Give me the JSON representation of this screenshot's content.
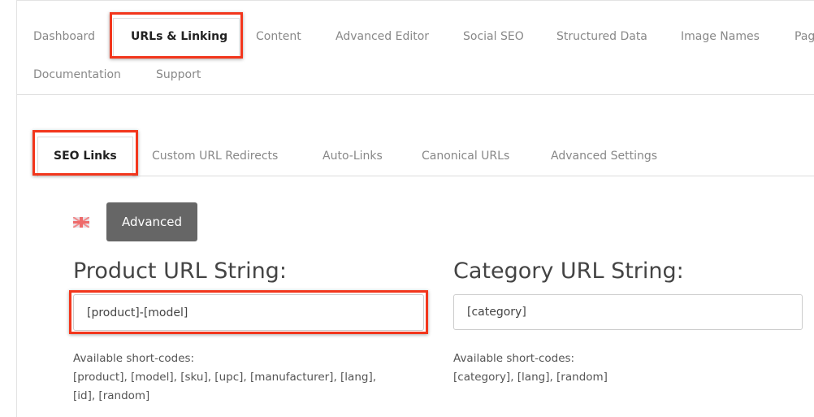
{
  "main_tabs": [
    {
      "label": "Dashboard",
      "active": false
    },
    {
      "label": "URLs & Linking",
      "active": true
    },
    {
      "label": "Content",
      "active": false
    },
    {
      "label": "Advanced Editor",
      "active": false
    },
    {
      "label": "Social SEO",
      "active": false
    },
    {
      "label": "Structured Data",
      "active": false
    },
    {
      "label": "Image Names",
      "active": false
    },
    {
      "label": "Pag",
      "active": false
    },
    {
      "label": "Documentation",
      "active": false
    },
    {
      "label": "Support",
      "active": false
    }
  ],
  "sub_tabs": [
    {
      "label": "SEO Links",
      "active": true
    },
    {
      "label": "Custom URL Redirects",
      "active": false
    },
    {
      "label": "Auto-Links",
      "active": false
    },
    {
      "label": "Canonical URLs",
      "active": false
    },
    {
      "label": "Advanced Settings",
      "active": false
    }
  ],
  "language_flag": "uk-flag-icon",
  "advanced_button": "Advanced",
  "product": {
    "title": "Product URL String:",
    "value": "[product]-[model]",
    "help_label": "Available short-codes:",
    "help_line1": "[product], [model], [sku], [upc], [manufacturer], [lang],",
    "help_line2": "[id], [random]"
  },
  "category": {
    "title": "Category URL String:",
    "value": "[category]",
    "help_label": "Available short-codes:",
    "help_line1": "[category], [lang], [random]"
  },
  "highlight_color": "#f2361c"
}
